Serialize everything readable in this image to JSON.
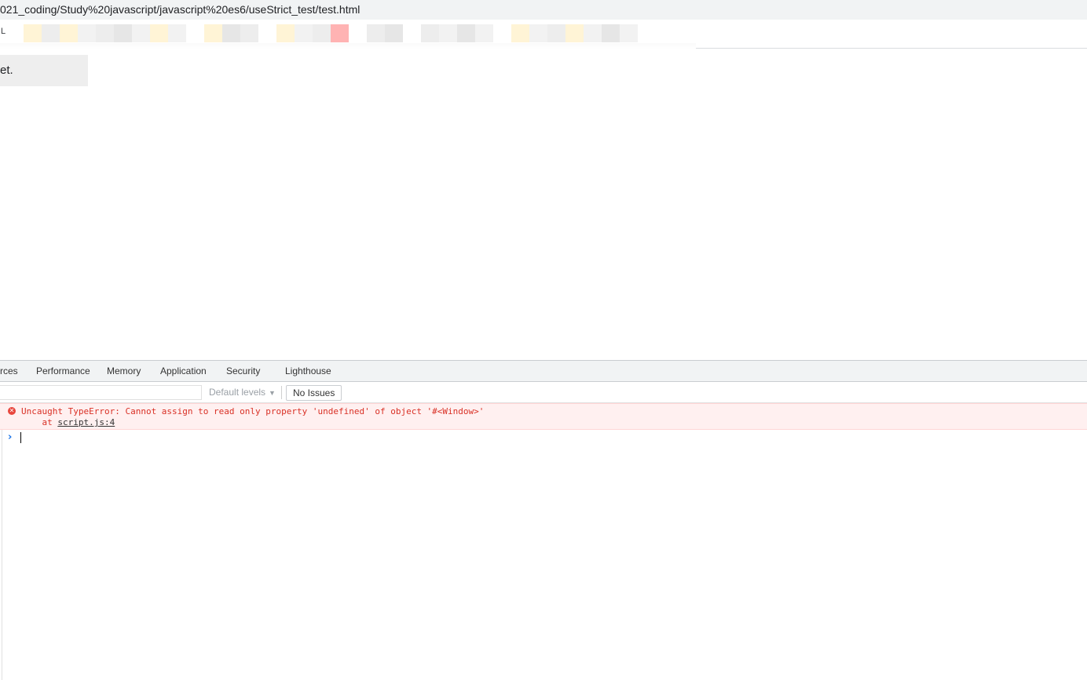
{
  "address_bar": {
    "url": "021_coding/Study%20javascript/javascript%20es6/useStrict_test/test.html"
  },
  "bookmarks_bar": {
    "leading_text": "L",
    "blur_colors": [
      "#fff4d6",
      "#ededed",
      "#fff4d6",
      "#f2f2f2",
      "#ededed",
      "#e6e6e6",
      "#f2f2f2",
      "#fff4d6",
      "#f2f2f2",
      "#ffffff",
      "#fff4d6",
      "#e6e6e6",
      "#ededed",
      "#ffffff",
      "#fff4d6",
      "#f2f2f2",
      "#ededed",
      "#ffb3b3",
      "#ffffff",
      "#ededed",
      "#e6e6e6",
      "#ffffff",
      "#ededed",
      "#f2f2f2",
      "#e6e6e6",
      "#f2f2f2",
      "#ffffff",
      "#fff4d6",
      "#f2f2f2",
      "#ededed",
      "#fff4d6",
      "#f2f2f2",
      "#e6e6e6",
      "#f2f2f2"
    ]
  },
  "page": {
    "output_text": "et."
  },
  "devtools": {
    "tabs": [
      {
        "label": "rces"
      },
      {
        "label": "Performance"
      },
      {
        "label": "Memory"
      },
      {
        "label": "Application"
      },
      {
        "label": "Security"
      },
      {
        "label": "Lighthouse"
      }
    ],
    "toolbar": {
      "filter_value": "",
      "levels_label": "Default levels",
      "levels_caret": "▼",
      "issues_label": "No Issues"
    },
    "console": {
      "error_icon": "✕",
      "error_line1": "Uncaught TypeError: Cannot assign to read only property 'undefined' of object '#<Window>'",
      "error_at": "    at ",
      "error_link": "script.js:4",
      "prompt_symbol": "›"
    }
  }
}
